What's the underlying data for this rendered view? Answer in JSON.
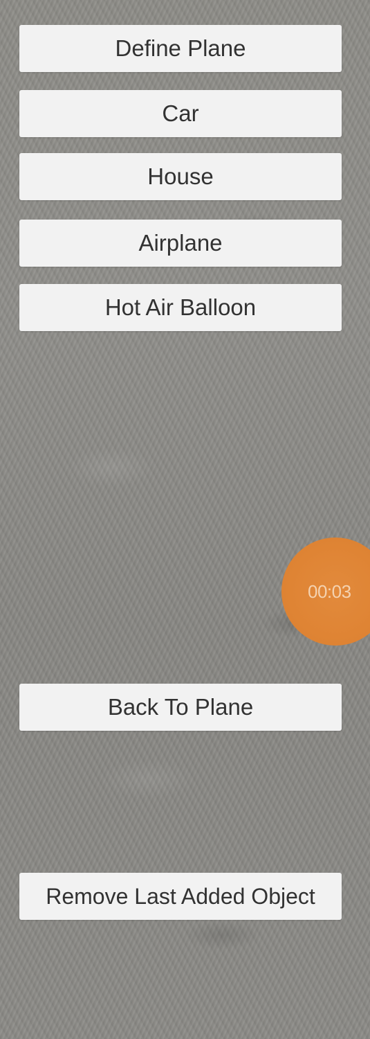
{
  "buttons": {
    "define_plane": "Define Plane",
    "car": "Car",
    "house": "House",
    "airplane": "Airplane",
    "hot_air_balloon": "Hot Air Balloon",
    "back_to_plane": "Back To Plane",
    "remove_last": "Remove Last Added Object"
  },
  "recorder": {
    "time": "00:03",
    "color": "#df8434"
  },
  "colors": {
    "button_bg": "#f2f2f2",
    "button_text": "#323232"
  }
}
